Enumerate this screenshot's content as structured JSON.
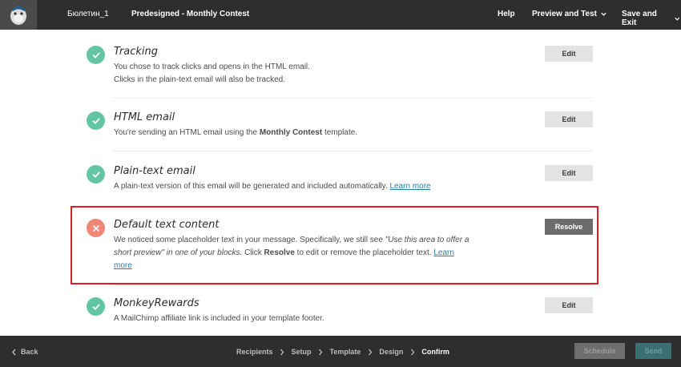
{
  "header": {
    "campaign_name": "Бюлетин_1",
    "title": "Predesigned - Monthly Contest",
    "help": "Help",
    "preview": "Preview and Test",
    "save_exit": "Save and Exit"
  },
  "items": [
    {
      "title": "Tracking",
      "desc_line1": "You chose to track clicks and opens in the HTML email.",
      "desc_line2": "Clicks in the plain-text email will also be tracked.",
      "button": "Edit",
      "status": "complete"
    },
    {
      "title": "HTML email",
      "desc_before": "You're sending an HTML email using the ",
      "desc_bold": "Monthly Contest",
      "desc_after": " template.",
      "button": "Edit",
      "status": "complete"
    },
    {
      "title": "Plain-text email",
      "desc": "A plain-text version of this email will be generated and included automatically. ",
      "link": "Learn more",
      "button": "Edit",
      "status": "complete"
    },
    {
      "title": "Default text content",
      "desc_a": "We noticed some placeholder text in your message. Specifically, we still see ",
      "desc_em": "\"Use this area to offer a short preview\" in one of your blocks.",
      "desc_b": " Click ",
      "desc_bold": "Resolve",
      "desc_c": " to edit or remove the placeholder text. ",
      "link": "Learn more",
      "button": "Resolve",
      "status": "error"
    },
    {
      "title": "MonkeyRewards",
      "desc": "A MailChimp affiliate link is included in your template footer.",
      "button": "Edit",
      "status": "complete"
    }
  ],
  "footer": {
    "back": "Back",
    "steps": [
      "Recipients",
      "Setup",
      "Template",
      "Design",
      "Confirm"
    ],
    "active_step": "Confirm",
    "schedule": "Schedule",
    "send": "Send"
  },
  "colors": {
    "topbar": "#2e2e2e",
    "success": "#63c5a4",
    "error": "#ef8676",
    "highlight": "#d92121",
    "link": "#277fa4"
  }
}
